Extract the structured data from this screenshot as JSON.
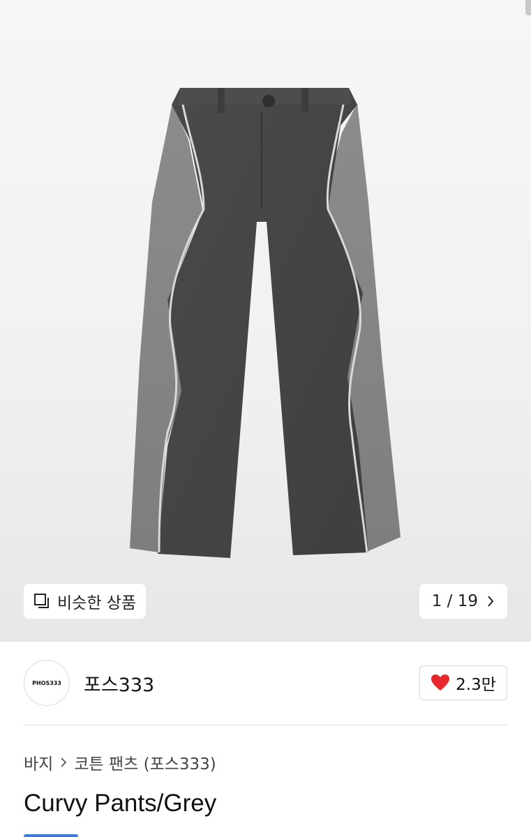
{
  "gallery": {
    "similar_label": "비슷한 상품",
    "page_indicator": "1 / 19"
  },
  "brand": {
    "logo_text": "PHOS333",
    "name": "포스333",
    "like_count": "2.3만",
    "heart_color": "#e8262c"
  },
  "breadcrumb": {
    "category": "바지",
    "subcategory": "코튼 팬츠 (포스333)"
  },
  "product": {
    "title": "Curvy Pants/Grey"
  }
}
